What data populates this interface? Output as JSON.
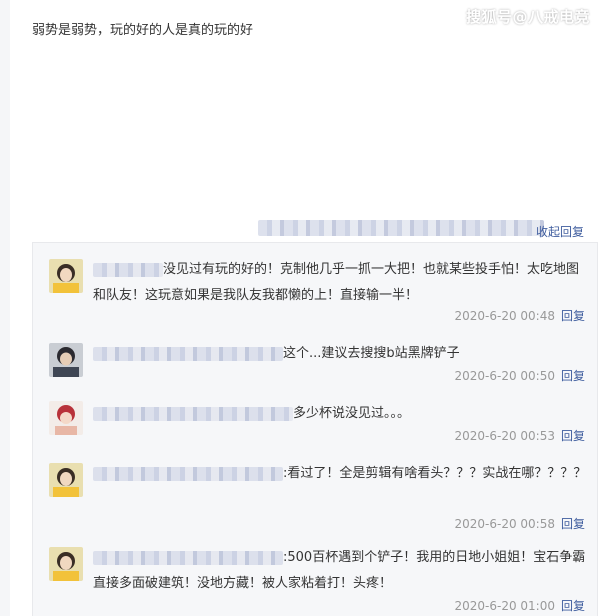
{
  "watermark": "搜狐号@八戒电竞",
  "main_comment": "弱势是弱势，玩的好的人是真的玩的好",
  "collapse_label": "收起回复",
  "replies": [
    {
      "text": "没见过有玩的好的！克制他几乎一抓一大把！也就某些投手怕！太吃地图和队友！这玩意如果是我队友我都懒的上！直接输一半！",
      "time": "2020-6-20 00:48",
      "reply_label": "回复",
      "avatar_icon": "user-avatar-icon"
    },
    {
      "text": "这个...建议去搜搜b站黑牌铲子",
      "time": "2020-6-20 00:50",
      "reply_label": "回复",
      "avatar_icon": "user-avatar-icon"
    },
    {
      "text": "多少杯说没见过。。。",
      "time": "2020-6-20 00:53",
      "reply_label": "回复",
      "avatar_icon": "user-avatar-icon"
    },
    {
      "text": ":看过了！全是剪辑有啥看头？？？实战在哪？？？？",
      "time": "2020-6-20 00:58",
      "reply_label": "回复",
      "avatar_icon": "user-avatar-icon"
    },
    {
      "text": ":500百杯遇到个铲子！我用的日地小姐姐！宝石争霸直接多面破建筑！没地方藏！被人家粘着打！头疼！",
      "time": "2020-6-20 01:00",
      "reply_label": "回复",
      "avatar_icon": "user-avatar-icon"
    }
  ]
}
